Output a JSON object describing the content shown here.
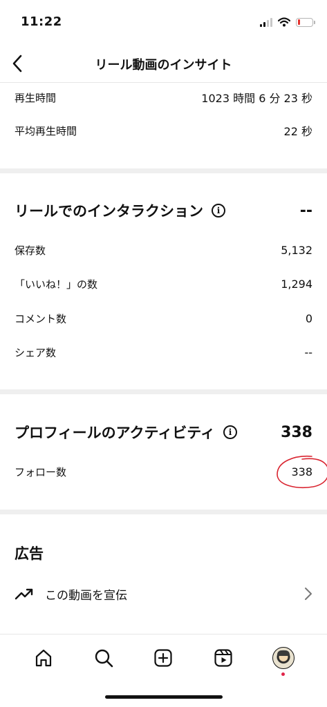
{
  "status_bar": {
    "time": "11:22",
    "signal_icon": "cellular-signal-icon",
    "wifi_icon": "wifi-icon",
    "battery_icon": "battery-low-icon",
    "battery_level": 0.1,
    "battery_color": "#e5342f"
  },
  "nav": {
    "back_icon": "chevron-left-icon",
    "title": "リール動画のインサイト"
  },
  "overview": {
    "rows": [
      {
        "label": "再生時間",
        "value": "1023 時間 6 分 23 秒"
      },
      {
        "label": "平均再生時間",
        "value": "22 秒"
      }
    ]
  },
  "interactions": {
    "title": "リールでのインタラクション",
    "info_icon": "info-icon",
    "total": "--",
    "rows": [
      {
        "label": "保存数",
        "value": "5,132"
      },
      {
        "label": "「いいね！」の数",
        "value": "1,294"
      },
      {
        "label": "コメント数",
        "value": "0"
      },
      {
        "label": "シェア数",
        "value": "--"
      }
    ]
  },
  "profile_activity": {
    "title": "プロフィールのアクティビティ",
    "info_icon": "info-icon",
    "total": "338",
    "rows": [
      {
        "label": "フォロー数",
        "value": "338"
      }
    ],
    "annotation_color": "#d9232f"
  },
  "ads": {
    "title": "広告",
    "promote_icon": "trending-up-icon",
    "promote_label": "この動画を宣伝",
    "chevron_icon": "chevron-right-icon"
  },
  "tab_bar": {
    "tabs": [
      {
        "icon": "home-icon"
      },
      {
        "icon": "search-icon"
      },
      {
        "icon": "create-plus-icon"
      },
      {
        "icon": "reels-icon"
      },
      {
        "icon": "profile-avatar-icon"
      }
    ],
    "notification_color": "#e0244a"
  }
}
